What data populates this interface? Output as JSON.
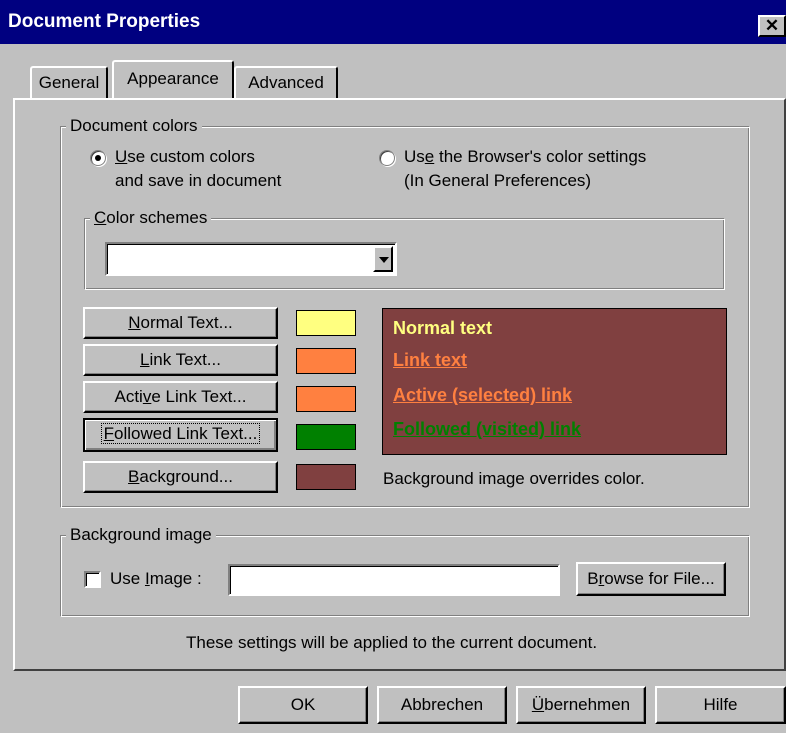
{
  "window": {
    "title": "Document Properties",
    "close_glyph": "✕"
  },
  "tabs": [
    {
      "label": "General",
      "active": false
    },
    {
      "label": "Appearance",
      "active": true
    },
    {
      "label": "Advanced",
      "active": false
    }
  ],
  "document_colors": {
    "legend": "Document colors",
    "radio_custom": {
      "hotkey": "U",
      "rest": "se custom colors",
      "line2": "and save in document",
      "checked": true
    },
    "radio_browser": {
      "pre": "Us",
      "hotkey": "e",
      "rest": " the Browser's color settings",
      "line2": "(In General Preferences)",
      "checked": false
    },
    "color_schemes": {
      "hotkey": "C",
      "rest": "olor schemes",
      "value": ""
    },
    "buttons": [
      {
        "pre": "",
        "hotkey": "N",
        "rest": "ormal Text...",
        "color": "#ffff80"
      },
      {
        "pre": "",
        "hotkey": "L",
        "rest": "ink Text...",
        "color": "#ff8040"
      },
      {
        "pre": "Acti",
        "hotkey": "v",
        "rest": "e Link Text...",
        "color": "#ff8040"
      },
      {
        "pre": "",
        "hotkey": "F",
        "rest": "ollowed Link Text...",
        "color": "#008000"
      },
      {
        "pre": "",
        "hotkey": "B",
        "rest": "ackground...",
        "color": "#804040"
      }
    ],
    "preview": {
      "background": "#804040",
      "normal": "Normal text",
      "link": "Link text",
      "active_link": "Active (selected) link",
      "followed_link": "Followed (visited) link"
    },
    "bg_note": "Background image overrides color."
  },
  "background_image": {
    "legend": "Background image",
    "use_image": {
      "pre": "Use ",
      "hotkey": "I",
      "rest": "mage :",
      "checked": false
    },
    "path": "",
    "browse": {
      "pre": "B",
      "hotkey": "r",
      "rest": "owse for File..."
    }
  },
  "info": "These settings will be applied to the current document.",
  "footer": {
    "ok": "OK",
    "cancel": "Abbrechen",
    "apply": {
      "hotkey": "Ü",
      "rest": "bernehmen"
    },
    "help": "Hilfe"
  }
}
